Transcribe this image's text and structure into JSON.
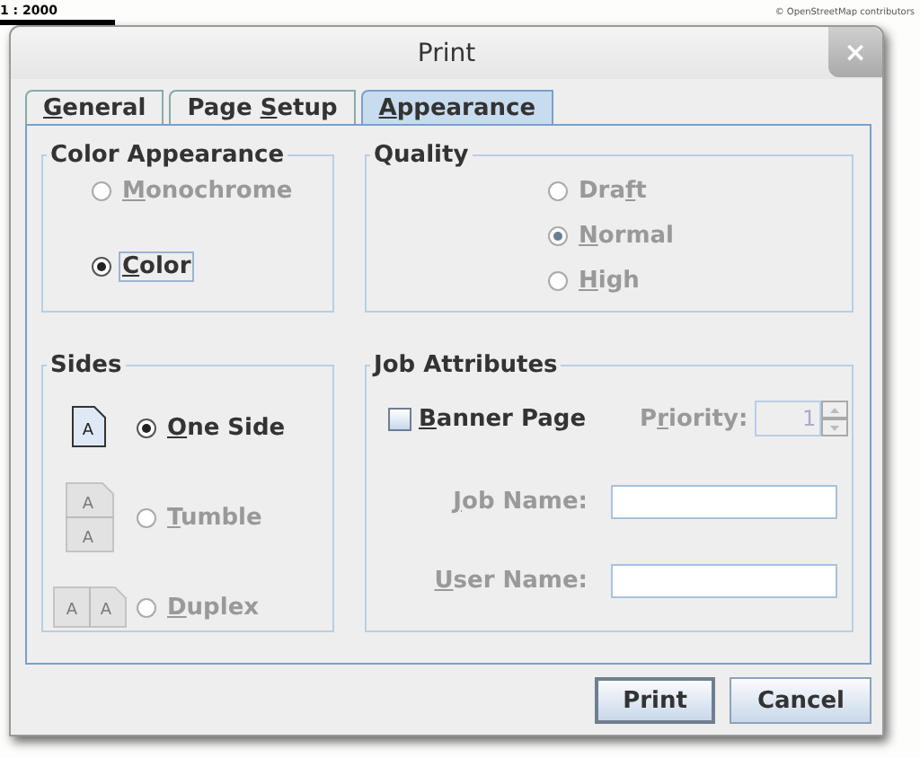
{
  "map": {
    "scale": "1 : 2000",
    "attribution": "© OpenStreetMap contributors"
  },
  "window": {
    "title": "Print",
    "close": "×"
  },
  "tabs": [
    {
      "key": "G",
      "post": "eneral",
      "selected": false
    },
    {
      "pre": "Page ",
      "key": "S",
      "post": "etup",
      "selected": false
    },
    {
      "key": "A",
      "post": "ppearance",
      "selected": true
    }
  ],
  "color_appearance": {
    "title": "Color Appearance",
    "options": [
      {
        "key": "M",
        "post": "onochrome",
        "selected": false,
        "disabled": true,
        "focused": false
      },
      {
        "key": "C",
        "post": "olor",
        "selected": true,
        "disabled": false,
        "focused": true
      }
    ]
  },
  "quality": {
    "title": "Quality",
    "options": [
      {
        "pre": "Dra",
        "key": "f",
        "post": "t",
        "selected": false,
        "disabled": true
      },
      {
        "key": "N",
        "post": "ormal",
        "selected": true,
        "disabled": true
      },
      {
        "key": "H",
        "post": "igh",
        "selected": false,
        "disabled": true
      }
    ]
  },
  "sides": {
    "title": "Sides",
    "options": [
      {
        "kind": "single",
        "key": "O",
        "post": "ne Side",
        "selected": true,
        "disabled": false,
        "glyphs": [
          "A"
        ]
      },
      {
        "kind": "tumble",
        "key": "T",
        "post": "umble",
        "selected": false,
        "disabled": true,
        "glyphs": [
          "A",
          "A"
        ]
      },
      {
        "kind": "duplex",
        "key": "D",
        "post": "uplex",
        "selected": false,
        "disabled": true,
        "glyphs": [
          "A",
          "A"
        ]
      }
    ]
  },
  "job_attributes": {
    "title": "Job Attributes",
    "banner": {
      "key": "B",
      "post": "anner Page",
      "checked": false
    },
    "priority": {
      "pre": "P",
      "key": "r",
      "post": "iority:",
      "value": "1",
      "disabled": true
    },
    "fields": [
      {
        "key": "J",
        "post": "ob Name:",
        "disabled": true
      },
      {
        "key": "U",
        "post": "ser Name:",
        "disabled": true
      }
    ]
  },
  "buttons": [
    {
      "label": "Print",
      "default": true
    },
    {
      "label": "Cancel",
      "default": false
    }
  ]
}
